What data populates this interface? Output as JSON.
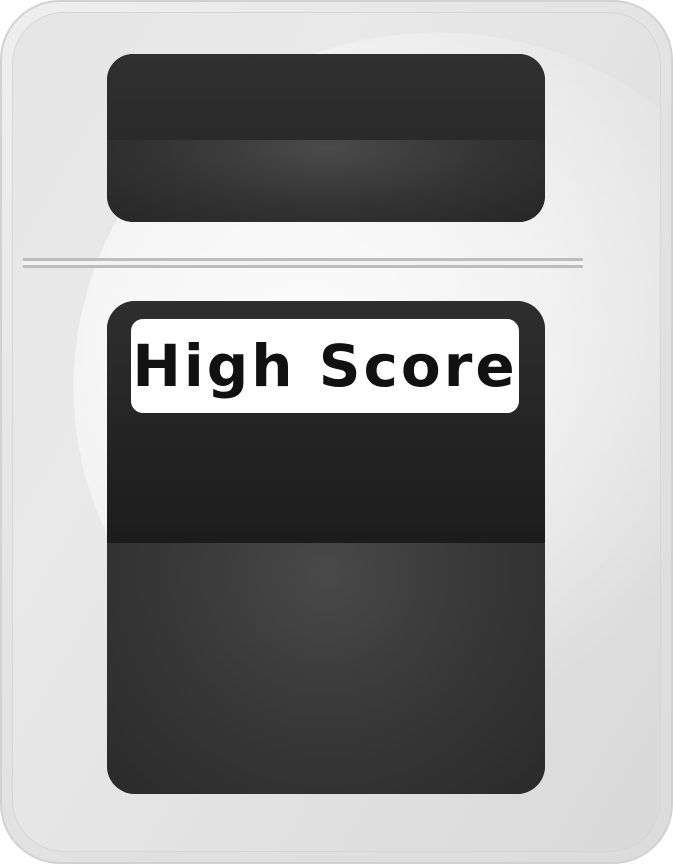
{
  "scoreboard": {
    "title": "High Score",
    "colors": {
      "panel_dark": "#2a2a2a",
      "panel_highlight": "#494949",
      "frame_light": "#e6e6e6",
      "label_bg": "#ffffff",
      "label_text": "#111111"
    }
  }
}
